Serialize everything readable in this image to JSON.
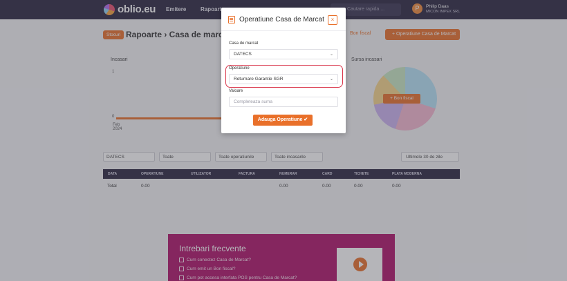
{
  "nav": {
    "brand": "oblio.eu",
    "items": [
      "Emitere",
      "Rapoarte"
    ],
    "search_placeholder": "Cautare rapida ...",
    "user_initial": "P",
    "user_name": "Philip Daas",
    "user_company": "MICON IMPEX SRL"
  },
  "page": {
    "badge": "Stocuri",
    "title": "Rapoarte › Casa de marcat",
    "bon_fiscal": "Bon fiscal",
    "add_operation": "+ Operatiune Casa de Marcat",
    "incasari_title": "Incasari",
    "sursa_title": "Sursa incasari",
    "axis_one": "1",
    "axis_zero": "0",
    "axis_date": "Feb 2024",
    "pie_button": "+ Bon fiscal"
  },
  "filters": {
    "casa": "DATECS",
    "f2": "Toate",
    "f3": "Toate operatiunile",
    "f4": "Toate incasarile",
    "period": "Ultimele 30 de zile"
  },
  "table": {
    "headers": [
      "DATA",
      "OPERATIUNE",
      "UTILIZATOR",
      "FACTURA",
      "NUMERAR",
      "CARD",
      "TICHETE",
      "PLATA MODERNA"
    ],
    "total_label": "Total",
    "total_values": [
      "0.00",
      "0.00",
      "0.00",
      "0.00",
      "0.00"
    ]
  },
  "faq": {
    "title": "Intrebari frecvente",
    "items": [
      "Cum conectez Casa de Marcat?",
      "Cum emit un Bon fiscal?",
      "Cum pot accesa interfata POS pentru Casa de Marcat?"
    ]
  },
  "modal": {
    "title": "Operatiune Casa de Marcat",
    "close": "×",
    "casa_label": "Casa de marcat",
    "casa_value": "DATECS",
    "operatiune_label": "Operatiune",
    "operatiune_value": "Returnare Garantie SGR",
    "valoare_label": "Valoare",
    "valoare_placeholder": "Completeaza suma",
    "submit": "Adauga Operatiune ✔"
  },
  "colors": {
    "accent": "#e9702a",
    "nav": "#2a2540",
    "faq": "#b0126a",
    "highlight": "#d9344a"
  }
}
